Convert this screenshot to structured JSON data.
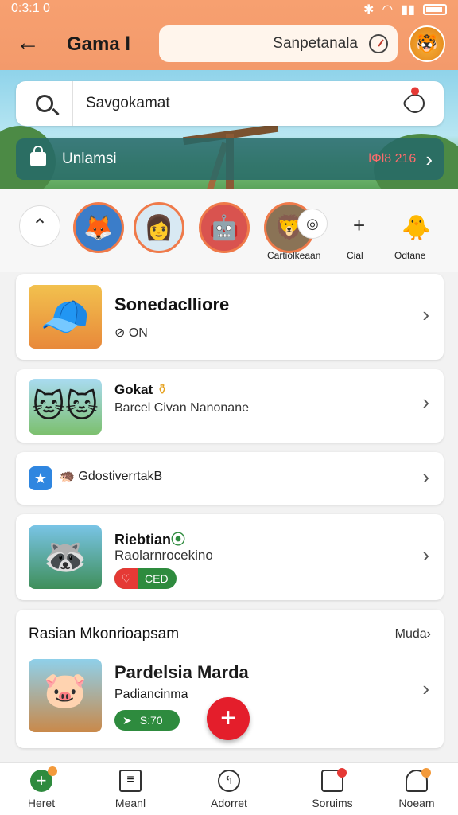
{
  "status_bar": {
    "time": "0:3:1 0"
  },
  "header": {
    "title": "Gama l",
    "search_value": "Sanpetanala"
  },
  "hero": {
    "search_value": "Savgokamat",
    "promo_label": "Unlamsi",
    "promo_amount": "lΦl8 216"
  },
  "stories": [
    {
      "label": ""
    },
    {
      "label": ""
    },
    {
      "label": ""
    },
    {
      "label": ""
    },
    {
      "label": "Cartiolkeaan"
    },
    {
      "label": "Cial"
    },
    {
      "label": "Odtane"
    }
  ],
  "cards": [
    {
      "title": "Sonedaclliore",
      "sub": "ON"
    },
    {
      "title": "Gokat",
      "sub": "Barcel Civan Nanonane"
    },
    {
      "title": "GdostiverrtakB"
    },
    {
      "title": "Riebtian",
      "sub": "Raolarnrocekino",
      "badge": "CED"
    }
  ],
  "section": {
    "header": "Rasian Mkonrioapsam",
    "more_label": "Muda",
    "item": {
      "title": "Pardelsia Marda",
      "sub": "Padiancinma",
      "badge": "S:70"
    }
  },
  "nav": [
    {
      "label": "Heret"
    },
    {
      "label": "Meanl"
    },
    {
      "label": "Adorret"
    },
    {
      "label": "Soruims"
    },
    {
      "label": "Noeam"
    }
  ],
  "colors": {
    "header": "#f39a6b",
    "accent_red": "#e41e2b",
    "green": "#2e8b3e"
  }
}
